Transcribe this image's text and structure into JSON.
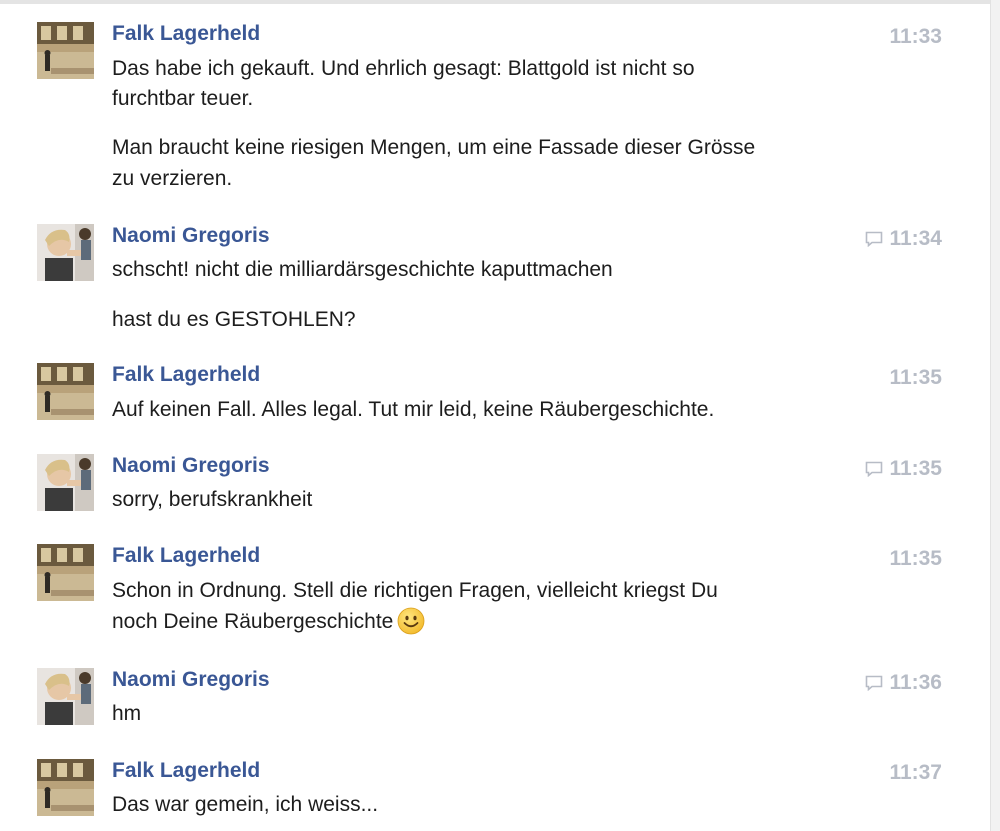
{
  "messages": [
    {
      "author": "Falk Lagerheld",
      "avatar": "falk-avatar",
      "time": "11:33",
      "has_reply_icon": false,
      "lines": [
        "Das habe ich gekauft. Und ehrlich gesagt: Blattgold ist nicht so",
        "furchtbar teuer.",
        "Man braucht keine riesigen Mengen, um eine Fassade dieser Grösse",
        "zu verzieren."
      ]
    },
    {
      "author": "Naomi Gregoris",
      "avatar": "naomi-avatar",
      "time": "11:34",
      "has_reply_icon": true,
      "lines": [
        "schscht! nicht die milliardärsgeschichte kaputtmachen",
        "hast du es GESTOHLEN?"
      ]
    },
    {
      "author": "Falk Lagerheld",
      "avatar": "falk-avatar",
      "time": "11:35",
      "has_reply_icon": false,
      "lines": [
        "Auf keinen Fall. Alles legal. Tut mir leid, keine Räubergeschichte."
      ]
    },
    {
      "author": "Naomi Gregoris",
      "avatar": "naomi-avatar",
      "time": "11:35",
      "has_reply_icon": true,
      "lines": [
        "sorry, berufskrankheit"
      ]
    },
    {
      "author": "Falk Lagerheld",
      "avatar": "falk-avatar",
      "time": "11:35",
      "has_reply_icon": false,
      "lines": [
        "Schon in Ordnung. Stell die richtigen Fragen, vielleicht kriegst Du",
        "noch Deine Räubergeschichte"
      ],
      "emoji": "smiley-emoji"
    },
    {
      "author": "Naomi Gregoris",
      "avatar": "naomi-avatar",
      "time": "11:36",
      "has_reply_icon": true,
      "lines": [
        "hm"
      ]
    },
    {
      "author": "Falk Lagerheld",
      "avatar": "falk-avatar",
      "time": "11:37",
      "has_reply_icon": false,
      "lines": [
        "Das war gemein, ich weiss..."
      ]
    }
  ],
  "colors": {
    "author_name": "#3a5795",
    "timestamp": "#b7bcc6",
    "message_text": "#1d1d1d"
  }
}
